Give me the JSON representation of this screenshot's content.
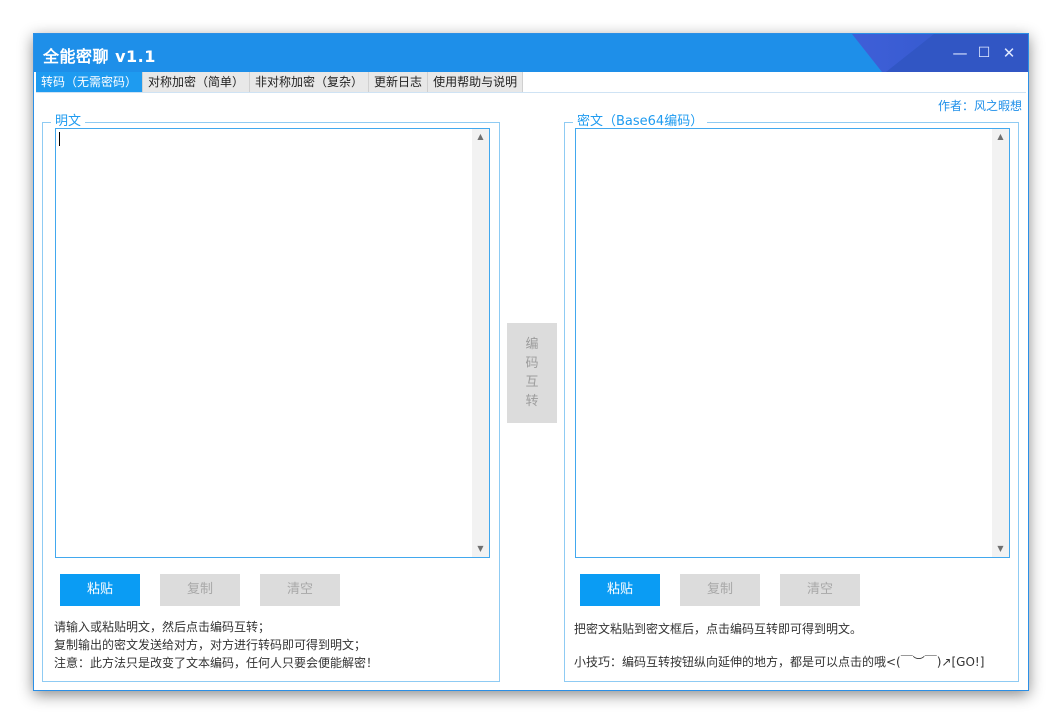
{
  "window": {
    "title": "全能密聊 v1.1",
    "controls": {
      "minimize": "—",
      "maximize": "☐",
      "close": "✕"
    }
  },
  "tabs": [
    {
      "label": "转码（无需密码）",
      "active": true
    },
    {
      "label": "对称加密（简单）",
      "active": false
    },
    {
      "label": "非对称加密（复杂）",
      "active": false
    },
    {
      "label": "更新日志",
      "active": false
    },
    {
      "label": "使用帮助与说明",
      "active": false
    }
  ],
  "author": "作者：风之暇想",
  "left_panel": {
    "legend": "明文",
    "text_value": "",
    "buttons": {
      "paste": "粘贴",
      "copy": "复制",
      "clear": "清空"
    },
    "hints": [
      "请输入或粘贴明文，然后点击编码互转；",
      "复制输出的密文发送给对方，对方进行转码即可得到明文；",
      "注意：此方法只是改变了文本编码，任何人只要会便能解密！"
    ]
  },
  "right_panel": {
    "legend": "密文（Base64编码）",
    "text_value": "",
    "buttons": {
      "paste": "粘贴",
      "copy": "复制",
      "clear": "清空"
    },
    "hints": [
      "把密文粘贴到密文框后，点击编码互转即可得到明文。",
      "小技巧：编码互转按钮纵向延伸的地方，都是可以点击的哦<(￣︶￣)↗[GO!]"
    ]
  },
  "convert_button": {
    "chars": [
      "编",
      "码",
      "互",
      "转"
    ]
  },
  "scroll_arrows": {
    "up": "▲",
    "down": "▼"
  },
  "colors": {
    "titlebar": "#1e8fe9",
    "accent": "#0a9cf4",
    "disabled": "#dcdcdc"
  }
}
